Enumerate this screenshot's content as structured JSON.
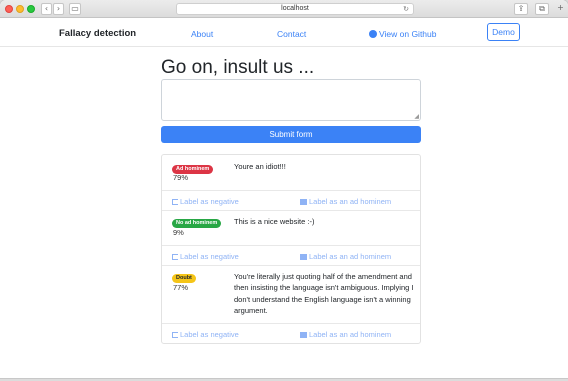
{
  "browser": {
    "url": "localhost",
    "back_glyph": "‹",
    "forward_glyph": "›",
    "sidebar_glyph": "▭",
    "reload_glyph": "↻",
    "share_glyph": "⇪",
    "tabs_glyph": "⧉",
    "newtab_glyph": "+"
  },
  "nav": {
    "brand": "Fallacy detection",
    "about": "About",
    "contact": "Contact",
    "github": "View on Github",
    "demo": "Demo",
    "github_icon": "github-icon"
  },
  "main": {
    "title": "Go on, insult us ...",
    "textarea_value": "",
    "textarea_placeholder": "",
    "submit_label": "Submit form"
  },
  "results": [
    {
      "badge": "Ad hominem",
      "badge_color": "#dc3545",
      "score": "79%",
      "text": "Youre an idiot!!!",
      "label_negative": "Label as negative",
      "label_positive": "Label as an ad hominem"
    },
    {
      "badge": "No ad hominem",
      "badge_color": "#28a745",
      "score": "9%",
      "text": "This is a nice website :-)",
      "label_negative": "Label as negative",
      "label_positive": "Label as an ad hominem"
    },
    {
      "badge": "Doubt",
      "badge_color": "#f5c518",
      "score": "77%",
      "text": "You're literally just quoting half of the amendment and then insisting the language isn't ambiguous. Implying I don't understand the English language isn't a winning argument.",
      "label_negative": "Label as negative",
      "label_positive": "Label as an ad hominem"
    }
  ]
}
